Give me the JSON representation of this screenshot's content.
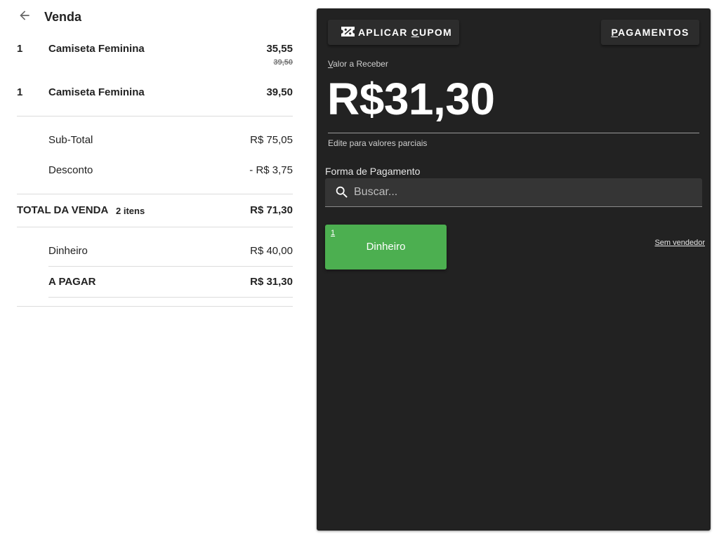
{
  "header": {
    "title": "Venda",
    "back_icon": "arrow-left-icon"
  },
  "items": [
    {
      "qty": "1",
      "name": "Camiseta Feminina",
      "price": "35,55",
      "old_price": "39,50"
    },
    {
      "qty": "1",
      "name": "Camiseta Feminina",
      "price": "39,50"
    }
  ],
  "summary": {
    "subtotal_label": "Sub-Total",
    "subtotal_value": "R$ 75,05",
    "discount_label": "Desconto",
    "discount_value": "- R$ 3,75",
    "total_label": "TOTAL DA VENDA",
    "total_count": "2 itens",
    "total_value": "R$ 71,30",
    "payment_label": "Dinheiro",
    "payment_value": "R$ 40,00",
    "due_label": "A PAGAR",
    "due_value": "R$ 31,30"
  },
  "panel": {
    "coupon_button": {
      "prefix": "APLICAR ",
      "underline": "C",
      "rest": "UPOM",
      "icon": "discount-ticket-icon"
    },
    "payments_button": {
      "underline": "P",
      "rest": "AGAMENTOS"
    },
    "amount_label_underline": "V",
    "amount_label_rest": "alor a Receber",
    "amount_value": "R$31,30",
    "amount_hint": "Edite para valores parciais",
    "form_label": "Forma de Pagamento",
    "search_placeholder": "Buscar...",
    "search_icon": "search-icon",
    "method": {
      "key": "1",
      "name": "Dinheiro",
      "color": "#4caf50"
    },
    "seller_link": "Sem vendedor"
  },
  "colors": {
    "panel_bg": "#222222",
    "accent_green": "#4caf50"
  }
}
